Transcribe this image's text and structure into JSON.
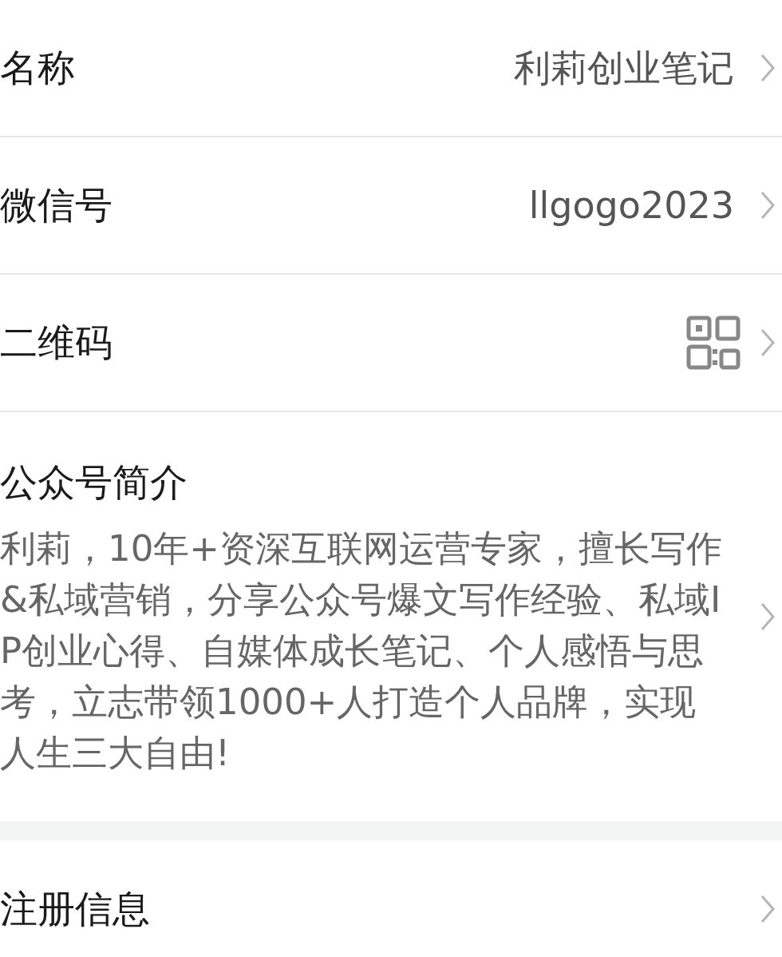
{
  "rows": [
    {
      "kind": "text",
      "label": "名称",
      "value": "利莉创业笔记"
    },
    {
      "kind": "text",
      "label": "微信号",
      "value": "llgogo2023"
    },
    {
      "kind": "qrcode",
      "label": "二维码"
    }
  ],
  "intro": {
    "label": "公众号简介",
    "text": "利莉，10年+资深互联网运营专家，擅长写作&私域营销，分享公众号爆文写作经验、私域IP创业心得、自媒体成长笔记、个人感悟与思考，立志带领1000+人打造个人品牌，实现人生三大自由!"
  },
  "registration": {
    "label": "注册信息"
  }
}
